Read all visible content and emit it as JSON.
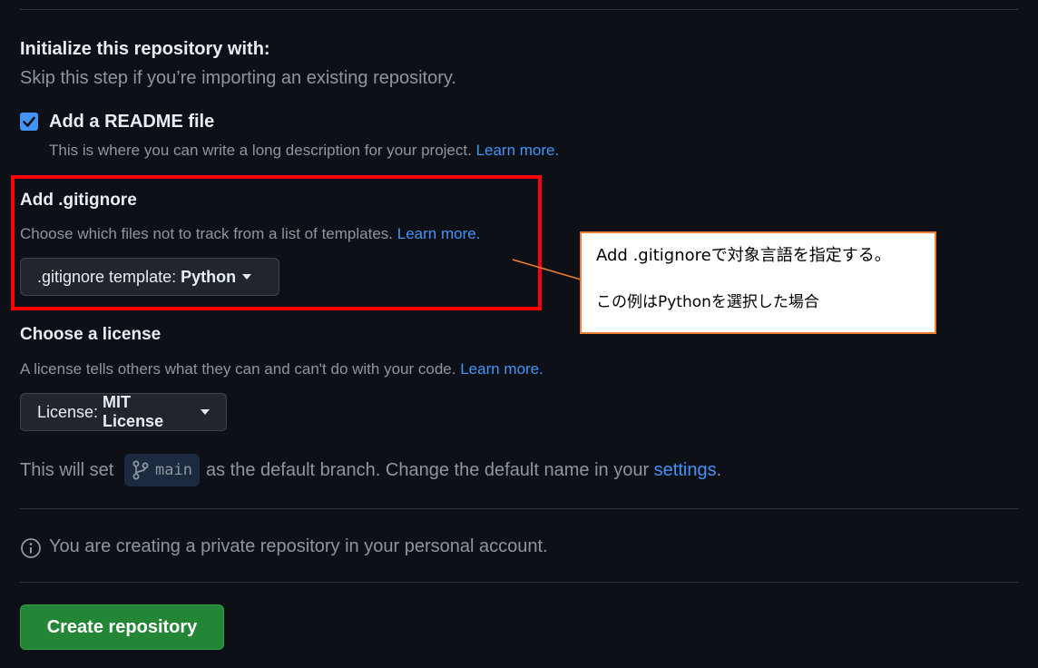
{
  "init": {
    "title": "Initialize this repository with:",
    "subtitle": "Skip this step if you’re importing an existing repository."
  },
  "readme": {
    "checked": true,
    "label": "Add a README file",
    "description": "This is where you can write a long description for your project.",
    "learn_more": "Learn more."
  },
  "gitignore": {
    "title": "Add .gitignore",
    "description": "Choose which files not to track from a list of templates.",
    "learn_more": "Learn more.",
    "select_prefix": ".gitignore template:",
    "select_value": "Python"
  },
  "license": {
    "title": "Choose a license",
    "description": "A license tells others what they can and can't do with your code.",
    "learn_more": "Learn more.",
    "select_prefix": "License:",
    "select_value": "MIT License"
  },
  "branch": {
    "prefix": "This will set",
    "name": "main",
    "middle": "as the default branch. Change the default name in your",
    "settings_link": "settings",
    "suffix": "."
  },
  "info": {
    "text": "You are creating a private repository in your personal account."
  },
  "create_button": "Create repository",
  "callout": {
    "line1": "Add .gitignoreで対象言語を指定する。",
    "line2": "この例はPythonを選択した場合"
  },
  "colors": {
    "background": "#0d1117",
    "link": "#4493f8",
    "create_button": "#238636",
    "highlight": "#ff0000",
    "callout_border": "#ed7d31"
  }
}
